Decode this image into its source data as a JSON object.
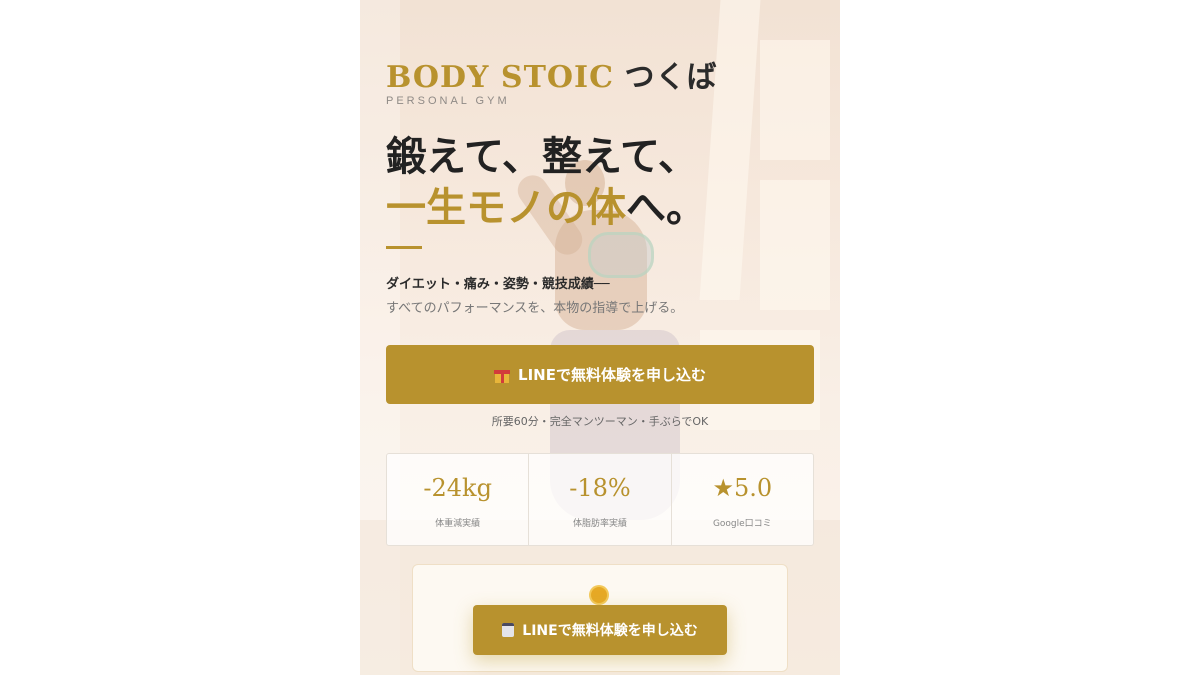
{
  "brand": {
    "name_en": "BODY STOIC",
    "name_jp": "つくば",
    "subtitle": "PERSONAL GYM"
  },
  "hero": {
    "line1": "鍛えて、整えて、",
    "line2_gold": "一生モノの体",
    "line2_rest": "へ。",
    "tagline": "ダイエット・痛み・姿勢・競技成績──",
    "subtagline": "すべてのパフォーマンスを、本物の指導で上げる。"
  },
  "cta_primary": {
    "label": "LINEで無料体験を申し込む",
    "icon": "gift-icon"
  },
  "cta_note": "所要60分・完全マンツーマン・手ぶらでOK",
  "stats": [
    {
      "value": "-24kg",
      "label": "体重減実績"
    },
    {
      "value": "-18%",
      "label": "体脂肪率実績"
    },
    {
      "value": "★5.0",
      "label": "Google口コミ"
    }
  ],
  "cta_secondary": {
    "label": "LINEで無料体験を申し込む",
    "icon": "calendar-icon",
    "badge_icon": "sun-badge-icon"
  },
  "colors": {
    "accent": "#b8922e",
    "text": "#222222"
  }
}
